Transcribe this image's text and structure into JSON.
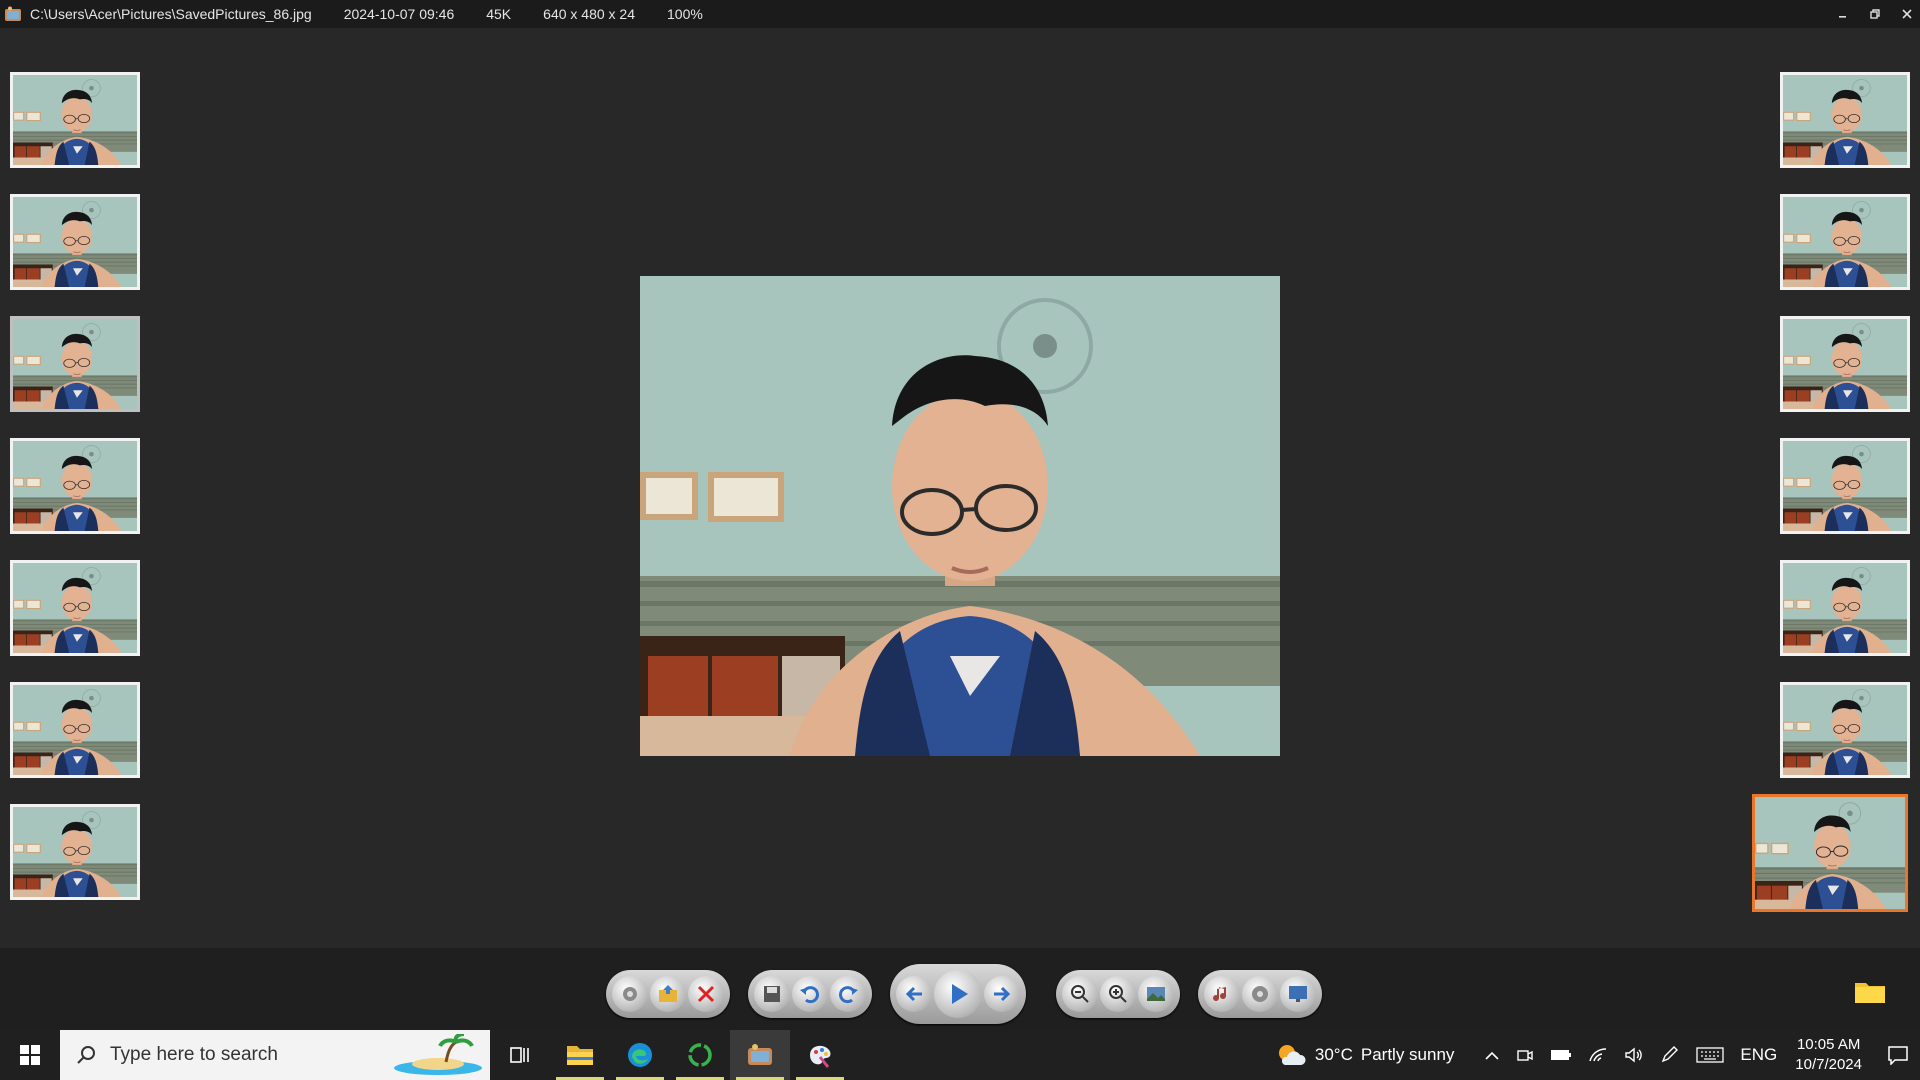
{
  "titlebar": {
    "path": "C:\\Users\\Acer\\Pictures\\SavedPictures_86.jpg",
    "date": "2024-10-07 09:46",
    "size": "45K",
    "dimensions": "640 x 480 x 24",
    "zoom": "100%",
    "controls": [
      "minimize",
      "restore",
      "close"
    ]
  },
  "thumbnails": {
    "left_count": 7,
    "right_count": 7,
    "selected": "right-7"
  },
  "toolbar": {
    "groups": [
      [
        "settings-icon",
        "open-folder-icon",
        "delete-icon"
      ],
      [
        "save-icon",
        "rotate-left-icon",
        "rotate-right-icon"
      ],
      [
        "previous-icon",
        "play-icon",
        "next-icon"
      ],
      [
        "zoom-out-icon",
        "zoom-in-icon",
        "fit-image-icon"
      ],
      [
        "music-icon",
        "options-icon",
        "slideshow-icon"
      ]
    ]
  },
  "taskbar": {
    "search_placeholder": "Type here to search",
    "apps": [
      "task-view-icon",
      "file-explorer-icon",
      "edge-icon",
      "circle-app-icon",
      "image-viewer-icon",
      "paint-icon"
    ],
    "weather_temp": "30°C",
    "weather_desc": "Partly sunny",
    "language": "ENG",
    "time": "10:05 AM",
    "date": "10/7/2024"
  },
  "colors": {
    "accent": "#e9762b",
    "background": "#282828",
    "taskbar": "#202020"
  }
}
